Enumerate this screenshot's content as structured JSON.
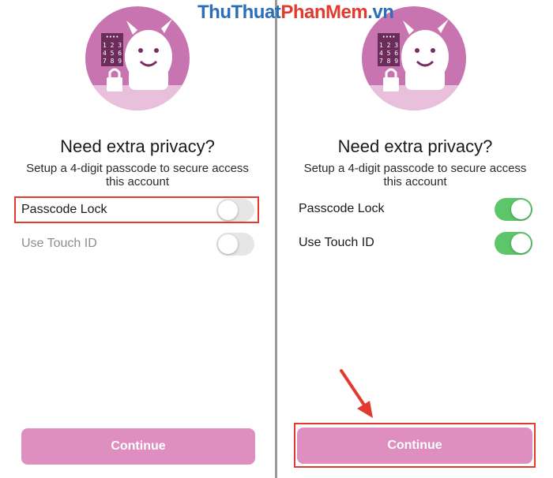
{
  "watermark": {
    "part1": "ThuThuat",
    "part2": "PhanMem",
    "part3": ".vn"
  },
  "left": {
    "heading": "Need extra privacy?",
    "subtext": "Setup a 4-digit passcode to secure access this account",
    "passcode_label": "Passcode Lock",
    "passcode_on": false,
    "touchid_label": "Use Touch ID",
    "touchid_on": false,
    "continue_label": "Continue"
  },
  "right": {
    "heading": "Need extra privacy?",
    "subtext": "Setup a 4-digit passcode to secure access this account",
    "passcode_label": "Passcode Lock",
    "passcode_on": true,
    "touchid_label": "Use Touch ID",
    "touchid_on": true,
    "continue_label": "Continue"
  },
  "keypad": {
    "dots": "••••",
    "row1": "1 2 3",
    "row2": "4 5 6",
    "row3": "7 8 9"
  },
  "colors": {
    "avatar_bg": "#c874b0",
    "avatar_floor": "#e9c0dc",
    "toggle_on": "#5dc56a",
    "button": "#df8fbf",
    "highlight": "#e23a2e"
  },
  "icons": {
    "avatar": "mascot-with-lock-and-keypad-icon",
    "arrow": "red-arrow-icon"
  }
}
